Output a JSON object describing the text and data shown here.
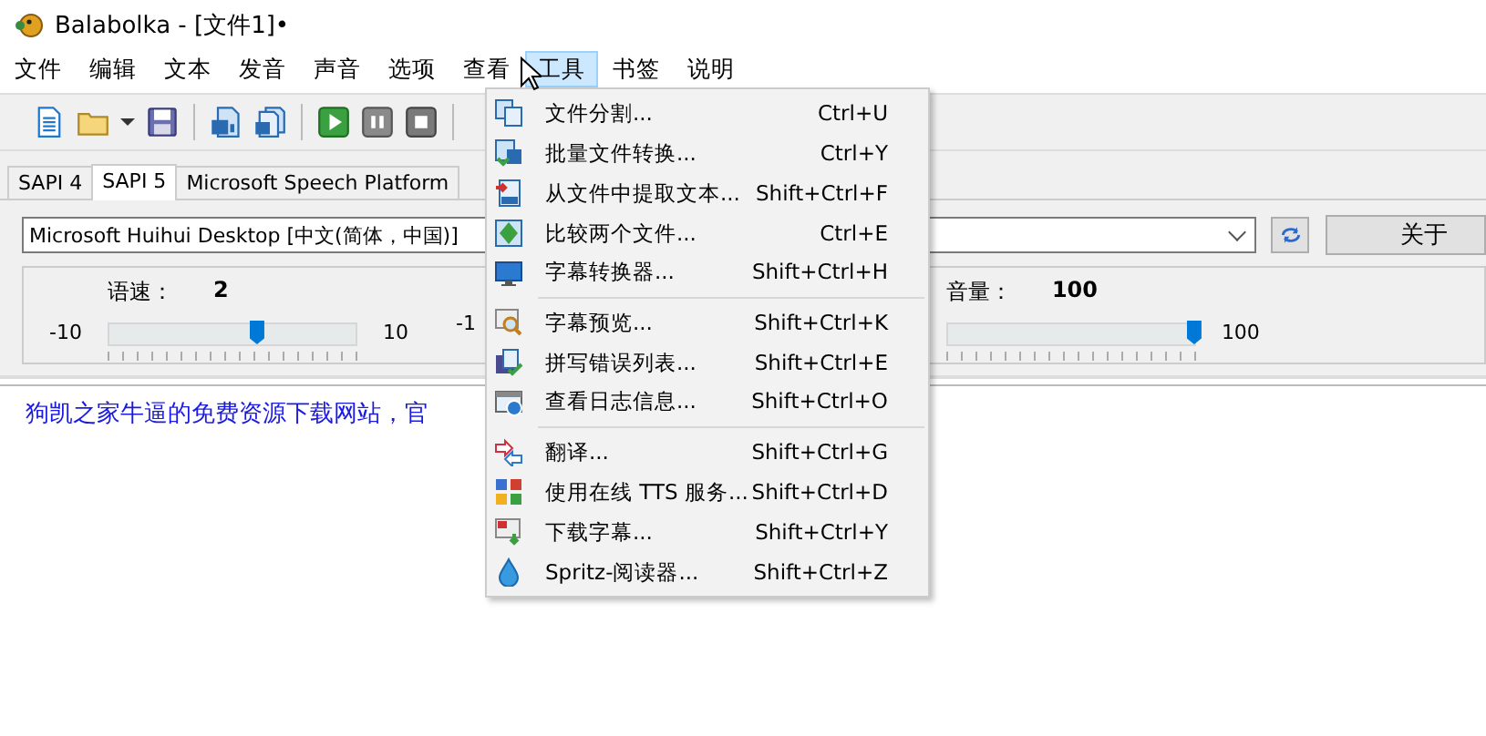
{
  "window": {
    "title": "Balabolka - [文件1]•"
  },
  "menu_bar": [
    {
      "label": "文件",
      "selected": false
    },
    {
      "label": "编辑",
      "selected": false
    },
    {
      "label": "文本",
      "selected": false
    },
    {
      "label": "发音",
      "selected": false
    },
    {
      "label": "声音",
      "selected": false
    },
    {
      "label": "选项",
      "selected": false
    },
    {
      "label": "查看",
      "selected": false
    },
    {
      "label": "工具",
      "selected": true
    },
    {
      "label": "书签",
      "selected": false
    },
    {
      "label": "说明",
      "selected": false
    }
  ],
  "tabs": [
    {
      "label": "SAPI 4",
      "selected": false
    },
    {
      "label": "SAPI 5",
      "selected": true
    },
    {
      "label": "Microsoft Speech Platform",
      "selected": false
    }
  ],
  "voice": {
    "value": "Microsoft Huihui Desktop [中文(简体，中国)]",
    "about_button": "关于"
  },
  "rate": {
    "label": "语速：",
    "value": "2",
    "min": "-10",
    "max": "10",
    "level": 0.6
  },
  "pitch": {
    "min": "-1"
  },
  "volume": {
    "label": "音量：",
    "value": "100",
    "max": "100",
    "level": 1
  },
  "editor": {
    "text": "狗凯之家牛逼的免费资源下载网站，官"
  },
  "tools_menu": [
    {
      "label": "文件分割...",
      "shortcut": "Ctrl+U",
      "separator_after": false
    },
    {
      "label": "批量文件转换...",
      "shortcut": "Ctrl+Y",
      "separator_after": false
    },
    {
      "label": "从文件中提取文本...",
      "shortcut": "Shift+Ctrl+F",
      "separator_after": false
    },
    {
      "label": "比较两个文件...",
      "shortcut": "Ctrl+E",
      "separator_after": false
    },
    {
      "label": "字幕转换器...",
      "shortcut": "Shift+Ctrl+H",
      "separator_after": true
    },
    {
      "label": "字幕预览...",
      "shortcut": "Shift+Ctrl+K",
      "separator_after": false
    },
    {
      "label": "拼写错误列表...",
      "shortcut": "Shift+Ctrl+E",
      "separator_after": false
    },
    {
      "label": "查看日志信息...",
      "shortcut": "Shift+Ctrl+O",
      "separator_after": true
    },
    {
      "label": "翻译...",
      "shortcut": "Shift+Ctrl+G",
      "separator_after": false
    },
    {
      "label": "使用在线 TTS 服务...",
      "shortcut": "Shift+Ctrl+D",
      "separator_after": false
    },
    {
      "label": "下载字幕...",
      "shortcut": "Shift+Ctrl+Y",
      "separator_after": false
    },
    {
      "label": "Spritz-阅读器...",
      "shortcut": "Shift+Ctrl+Z",
      "separator_after": false
    }
  ]
}
